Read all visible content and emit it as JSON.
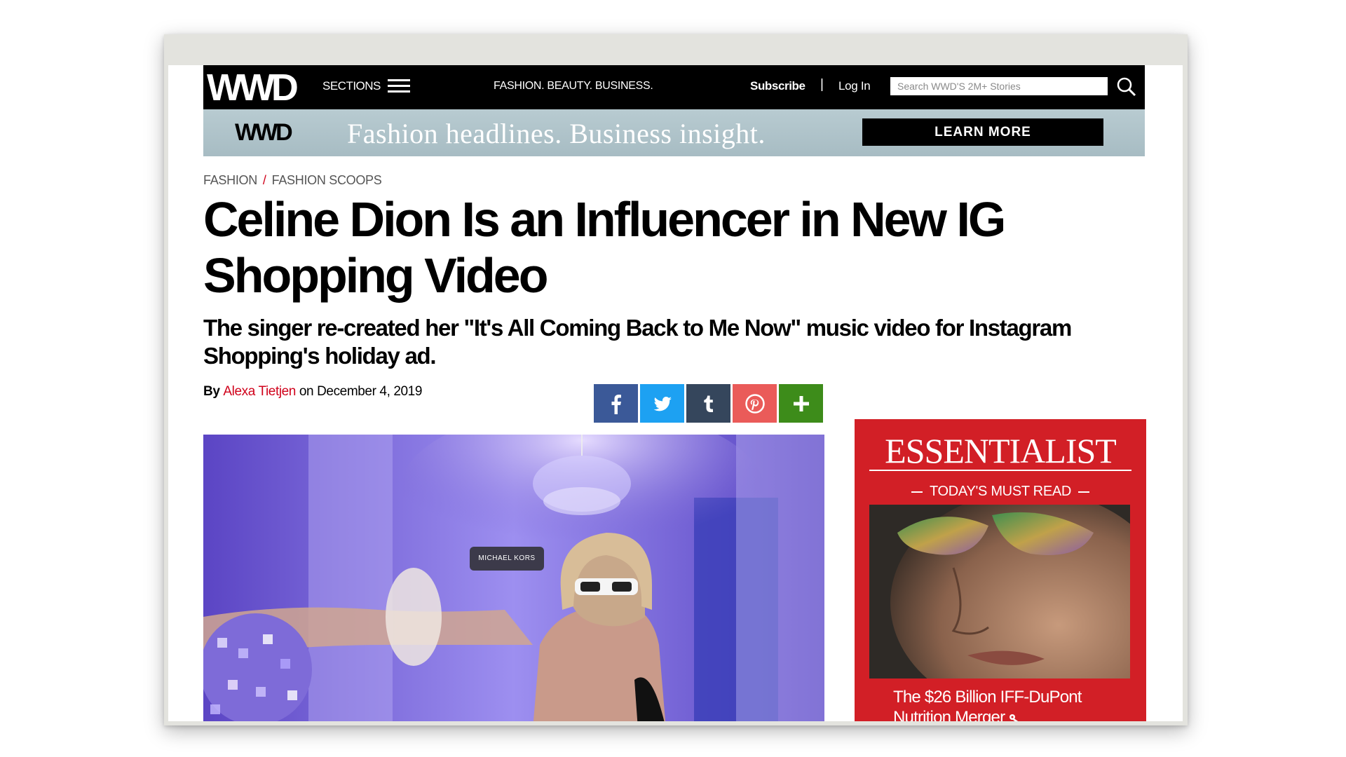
{
  "header": {
    "logo": "WWD",
    "sections_label": "SECTIONS",
    "tagline": "FASHION. BEAUTY. BUSINESS.",
    "subscribe": "Subscribe",
    "separator": "|",
    "login": "Log In",
    "search_placeholder": "Search WWD'S 2M+ Stories"
  },
  "promo": {
    "logo": "WWD",
    "text": "Fashion headlines. Business insight.",
    "button": "LEARN MORE"
  },
  "breadcrumb": [
    "FASHION",
    "FASHION SCOOPS"
  ],
  "article": {
    "headline": "Celine Dion Is an Influencer in New IG Shopping Video",
    "dek": "The singer re-created her \"It's All Coming Back to Me Now\" music video for Instagram Shopping's holiday ad.",
    "by": "By",
    "author": "Alexa Tietjen",
    "date": "on December 4, 2019"
  },
  "share_buttons": [
    {
      "name": "facebook",
      "color": "#3b5998"
    },
    {
      "name": "twitter",
      "color": "#1da1f2"
    },
    {
      "name": "tumblr",
      "color": "#35465c"
    },
    {
      "name": "pinterest",
      "color": "#ea5b59"
    },
    {
      "name": "more",
      "color": "#3d8c1a"
    }
  ],
  "hero": {
    "tag": "MICHAEL KORS"
  },
  "sidebar": {
    "title": "ESSENTIALIST",
    "subtitle": "TODAY'S MUST READ",
    "headline": "The $26 Billion IFF-DuPont Nutrition Merger",
    "accent": "#d21f26"
  }
}
